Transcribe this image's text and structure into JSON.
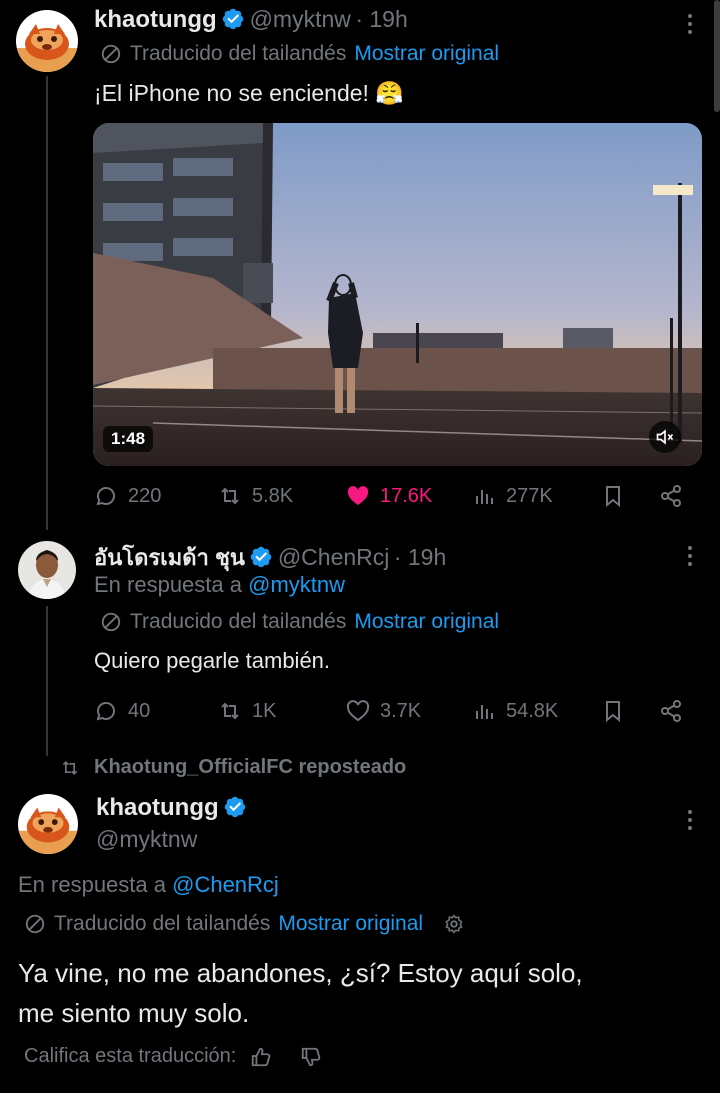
{
  "tweet1": {
    "name": "khaotungg",
    "handle": "@myktnw",
    "time": "· 19h",
    "translated": "Traducido del tailandés",
    "show_original": "Mostrar original",
    "text": "¡El iPhone no se enciende! 😤",
    "video_duration": "1:48",
    "replies": "220",
    "reposts": "5.8K",
    "likes": "17.6K",
    "views": "277K"
  },
  "tweet2": {
    "name": "อันโดรเมด้า ชุน",
    "handle": "@ChenRcj",
    "time": "· 19h",
    "reply_prefix": "En respuesta a",
    "reply_to": "@myktnw",
    "translated": "Traducido del tailandés",
    "show_original": "Mostrar original",
    "text": "Quiero pegarle también.",
    "replies": "40",
    "reposts": "1K",
    "likes": "3.7K",
    "views": "54.8K"
  },
  "repost_banner": "Khaotung_OfficialFC reposteado",
  "tweet3": {
    "name": "khaotungg",
    "handle": "@myktnw",
    "reply_prefix": "En respuesta a",
    "reply_to": "@ChenRcj",
    "translated": "Traducido del tailandés",
    "show_original": "Mostrar original",
    "text_line1": "Ya vine, no me abandones, ¿sí? Estoy aquí solo,",
    "text_line2": "me siento muy solo.",
    "rate": "Califica esta traducción:"
  },
  "colors": {
    "accent": "#1d9bf0",
    "like": "#f91880",
    "muted": "#71767b",
    "bg": "#000000"
  }
}
